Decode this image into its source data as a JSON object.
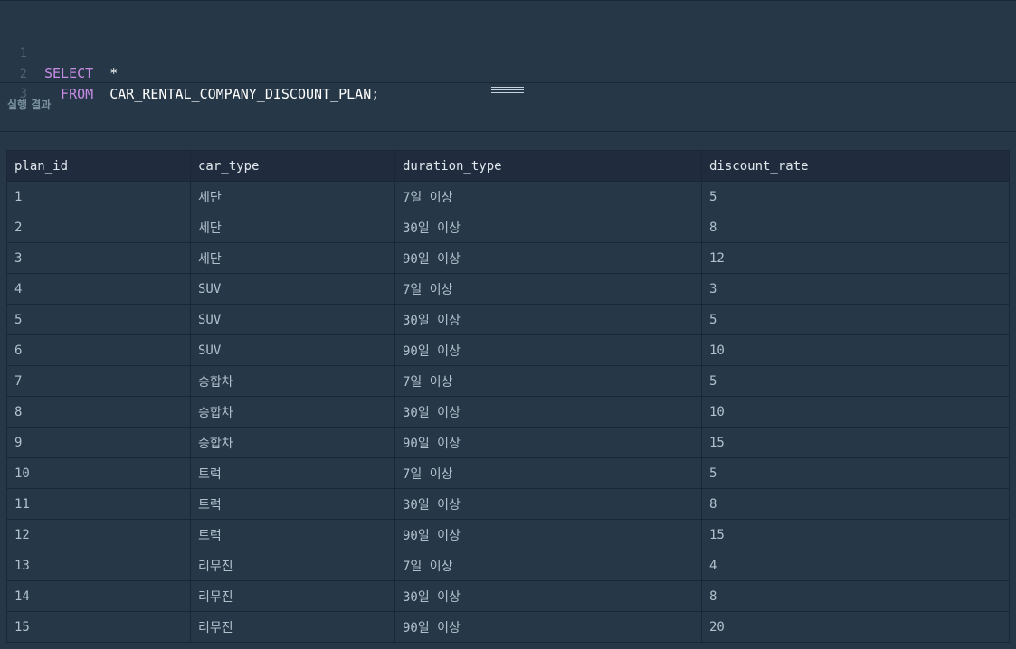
{
  "editor": {
    "lines": [
      {
        "num": "1",
        "keyword": "SELECT",
        "rest": "  *"
      },
      {
        "num": "2",
        "keyword": "  FROM",
        "rest": "  CAR_RENTAL_COMPANY_DISCOUNT_PLAN;"
      },
      {
        "num": "3",
        "keyword": "",
        "rest": ""
      }
    ]
  },
  "results": {
    "title": "실행 결과",
    "columns": [
      "plan_id",
      "car_type",
      "duration_type",
      "discount_rate"
    ],
    "rows": [
      [
        "1",
        "세단",
        "7일 이상",
        "5"
      ],
      [
        "2",
        "세단",
        "30일 이상",
        "8"
      ],
      [
        "3",
        "세단",
        "90일 이상",
        "12"
      ],
      [
        "4",
        "SUV",
        "7일 이상",
        "3"
      ],
      [
        "5",
        "SUV",
        "30일 이상",
        "5"
      ],
      [
        "6",
        "SUV",
        "90일 이상",
        "10"
      ],
      [
        "7",
        "승합차",
        "7일 이상",
        "5"
      ],
      [
        "8",
        "승합차",
        "30일 이상",
        "10"
      ],
      [
        "9",
        "승합차",
        "90일 이상",
        "15"
      ],
      [
        "10",
        "트럭",
        "7일 이상",
        "5"
      ],
      [
        "11",
        "트럭",
        "30일 이상",
        "8"
      ],
      [
        "12",
        "트럭",
        "90일 이상",
        "15"
      ],
      [
        "13",
        "리무진",
        "7일 이상",
        "4"
      ],
      [
        "14",
        "리무진",
        "30일 이상",
        "8"
      ],
      [
        "15",
        "리무진",
        "90일 이상",
        "20"
      ]
    ]
  },
  "colors": {
    "background": "#263747",
    "header_background": "#202b3d",
    "keyword": "#c98ce6",
    "line_number": "#4f6175",
    "cell_text": "#b2c0cc"
  }
}
